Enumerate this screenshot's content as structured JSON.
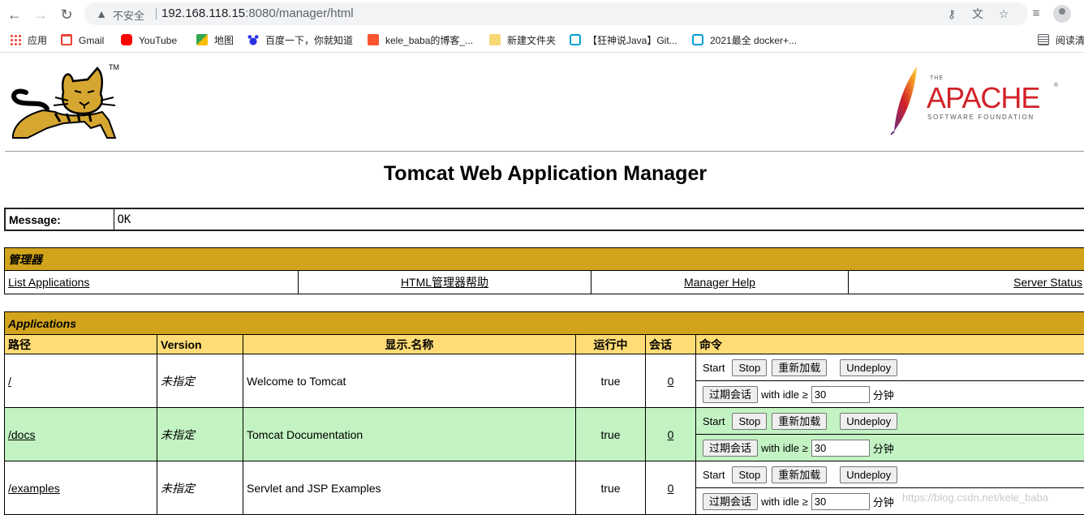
{
  "browser": {
    "insecure_label": "不安全",
    "url_host": "192.168.118.15",
    "url_rest": ":8080/manager/html",
    "bookmarks": [
      {
        "label": "应用",
        "color": "#e94235"
      },
      {
        "label": "Gmail",
        "color": "#ea4335"
      },
      {
        "label": "YouTube",
        "color": "#ff0000"
      },
      {
        "label": "地图",
        "color": "#34a853"
      },
      {
        "label": "百度一下，你就知道",
        "color": "#2932e1"
      },
      {
        "label": "kele_baba的博客_...",
        "color": "#fc5531"
      },
      {
        "label": "新建文件夹",
        "color": "#f8d775"
      },
      {
        "label": "【狂神说Java】Git...",
        "color": "#00a1d6"
      },
      {
        "label": "2021最全 docker+...",
        "color": "#00a1d6"
      }
    ],
    "reading_list": "阅读清"
  },
  "header": {
    "tomcat_tm": "TM",
    "apache_the": "THE",
    "apache_name": "APACHE",
    "apache_sub": "SOFTWARE FOUNDATION"
  },
  "title": "Tomcat Web Application Manager",
  "message": {
    "label": "Message:",
    "value": "OK"
  },
  "manager": {
    "heading": "管理器",
    "links": [
      "List Applications",
      "HTML管理器帮助",
      "Manager Help",
      "Server Status"
    ]
  },
  "applications": {
    "heading": "Applications",
    "columns": [
      "路径",
      "Version",
      "显示.名称",
      "运行中",
      "会话",
      "命令"
    ],
    "rows": [
      {
        "path": "/",
        "version": "未指定",
        "display_name": "Welcome to Tomcat",
        "running": "true",
        "sessions": "0"
      },
      {
        "path": "/docs",
        "version": "未指定",
        "display_name": "Tomcat Documentation",
        "running": "true",
        "sessions": "0"
      },
      {
        "path": "/examples",
        "version": "未指定",
        "display_name": "Servlet and JSP Examples",
        "running": "true",
        "sessions": "0"
      }
    ],
    "commands": {
      "start": "Start",
      "stop": "Stop",
      "reload": "重新加载",
      "undeploy": "Undeploy",
      "expire": "过期会话",
      "with_idle": "with idle ≥",
      "idle_value": "30",
      "minutes": "分钟"
    }
  },
  "watermark": "https://blog.csdn.net/kele_baba"
}
